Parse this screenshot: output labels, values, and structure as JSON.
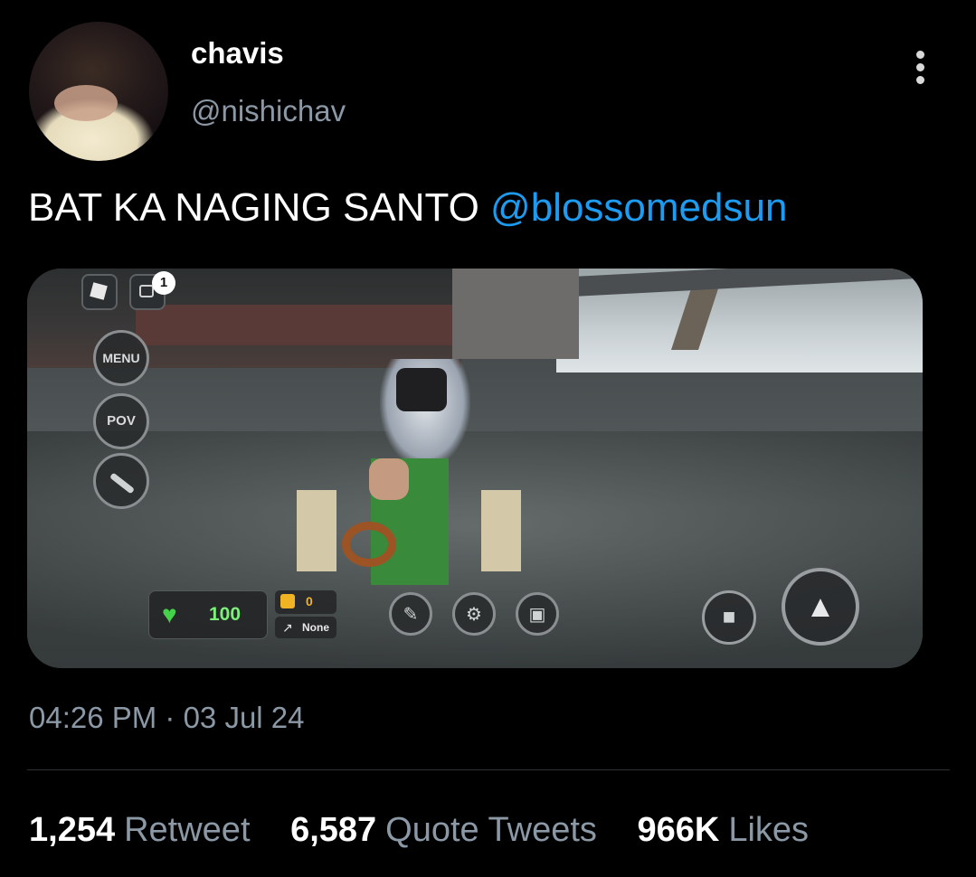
{
  "user": {
    "name": "chavis",
    "handle": "@nishichav"
  },
  "tweet": {
    "text": "BAT KA NAGING SANTO ",
    "mention": "@blossomedsun",
    "timestamp": "04:26 PM · 03 Jul 24"
  },
  "game_hud": {
    "notification_count": "1",
    "menu_label": "MENU",
    "pov_label": "POV",
    "health": "100",
    "coins": "0",
    "equipped_item": "None"
  },
  "stats": [
    {
      "count": "1,254",
      "label": "Retweet"
    },
    {
      "count": "6,587",
      "label": "Quote Tweets"
    },
    {
      "count": "966K",
      "label": "Likes"
    }
  ]
}
